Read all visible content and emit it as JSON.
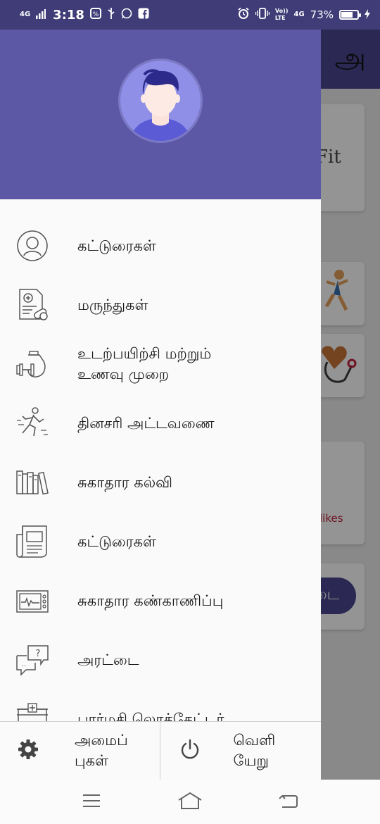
{
  "status_bar": {
    "network": "4G",
    "time": "3:18",
    "volte": "Vo))\nLTE",
    "network2": "4G",
    "battery": "73%",
    "battery_level": 0.73
  },
  "background": {
    "language_button": "அ",
    "card_text": "Fit",
    "likes_text": "likes",
    "pill_text": "டை"
  },
  "drawer": {
    "menu": [
      {
        "label": "கட்டுரைகள்",
        "icon": "user-outline-icon"
      },
      {
        "label": "மருந்துகள்",
        "icon": "prescription-icon"
      },
      {
        "label": "உடற்பயிற்சி மற்றும்\nஉணவு முறை",
        "icon": "fitness-diet-icon"
      },
      {
        "label": "தினசரி அட்டவணை",
        "icon": "running-man-icon"
      },
      {
        "label": "சுகாதார கல்வி",
        "icon": "books-icon"
      },
      {
        "label": "கட்டுரைகள்",
        "icon": "newspaper-icon"
      },
      {
        "label": "சுகாதார கண்காணிப்பு",
        "icon": "health-monitor-icon"
      },
      {
        "label": "அரட்டை",
        "icon": "chat-icon"
      },
      {
        "label": "பார்மசி லொக்கேட்டர்",
        "icon": "pharmacy-icon"
      }
    ],
    "footer": {
      "settings_label": "அமைப்\nபுகள்",
      "logout_label": "வெளி\nயேறு"
    }
  },
  "colors": {
    "status_bar": "#3f3c77",
    "drawer_header": "#5c58a6",
    "accent": "#4a4690",
    "likes": "#c0243d"
  }
}
